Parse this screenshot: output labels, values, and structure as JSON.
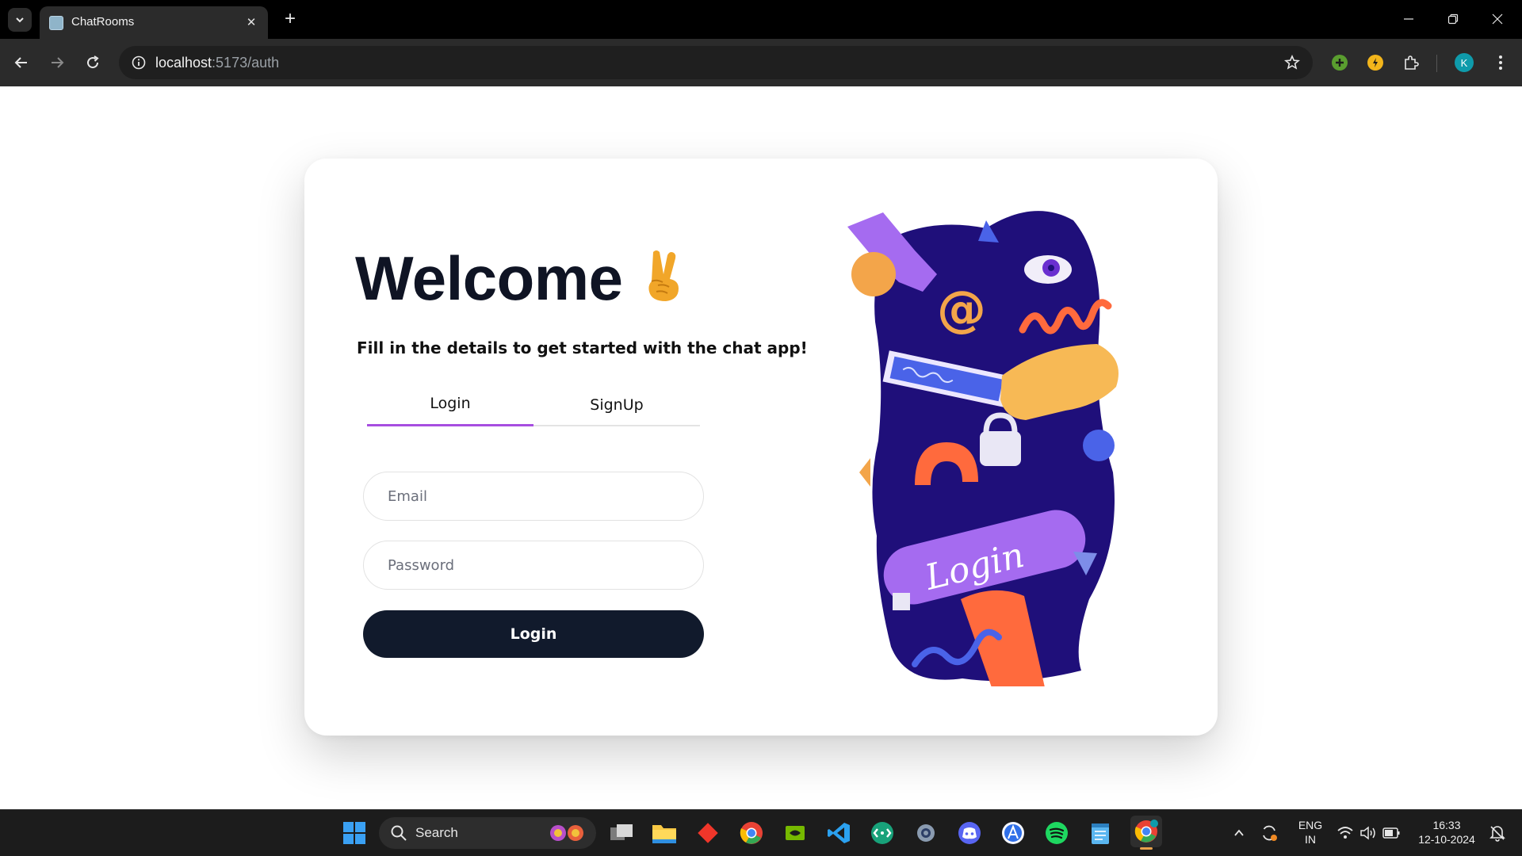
{
  "browser": {
    "tab_title": "ChatRooms",
    "url_host": "localhost",
    "url_path": ":5173/auth",
    "profile_initial": "K"
  },
  "page": {
    "heading": "Welcome",
    "subtitle": "Fill in the details to get started with the chat app!",
    "tabs": [
      {
        "label": "Login",
        "active": true
      },
      {
        "label": "SignUp",
        "active": false
      }
    ],
    "email_placeholder": "Email",
    "password_placeholder": "Password",
    "submit_label": "Login",
    "illustration_text": "Login"
  },
  "taskbar": {
    "search_label": "Search",
    "language_line1": "ENG",
    "language_line2": "IN",
    "time": "16:33",
    "date": "12-10-2024"
  },
  "colors": {
    "accent_tab_underline": "#a74ee0",
    "button_bg": "#111a2c",
    "illustration_bg": "#1f0f7a"
  },
  "icons": [
    "tab-menu-icon",
    "close-icon",
    "plus-icon",
    "minimize-icon",
    "restore-icon",
    "window-close-icon",
    "back-icon",
    "forward-icon",
    "reload-icon",
    "site-info-icon",
    "star-icon",
    "extension-green-icon",
    "extension-yellow-icon",
    "puzzle-icon",
    "profile-avatar",
    "more-icon",
    "windows-start-icon",
    "search-icon",
    "task-view-icon",
    "file-explorer-icon",
    "git-icon",
    "chrome-icon",
    "nvidia-icon",
    "vscode-icon",
    "network-icon",
    "settings-icon",
    "discord-icon",
    "app-icon",
    "spotify-icon",
    "notepad-icon",
    "chrome-active-icon",
    "chevron-up-icon",
    "sync-icon",
    "wifi-icon",
    "volume-icon",
    "battery-icon",
    "notifications-icon"
  ]
}
